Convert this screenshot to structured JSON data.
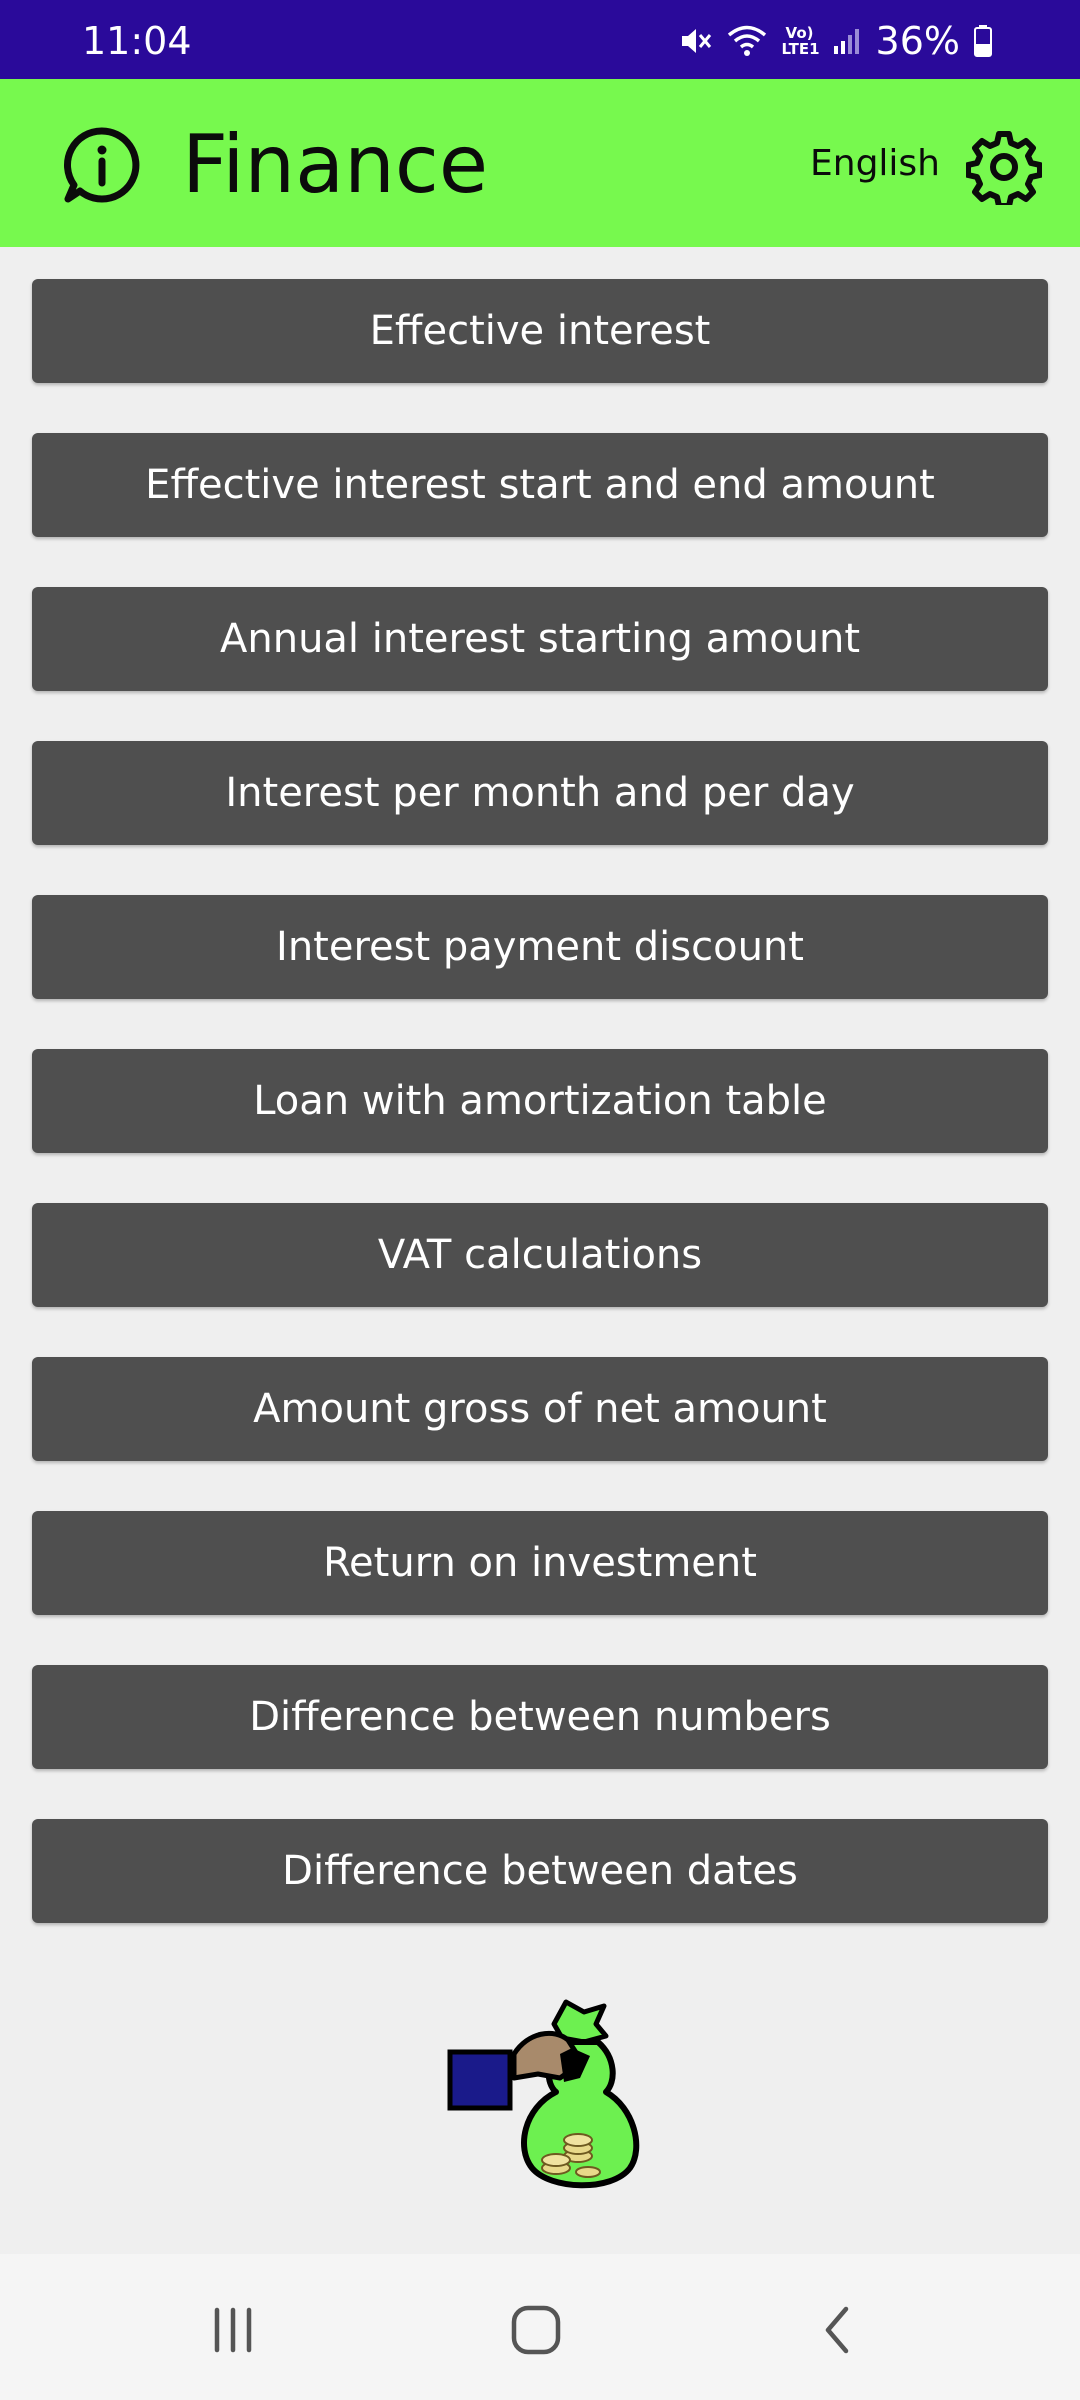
{
  "status_bar": {
    "time": "11:04",
    "network": "Vo) LTE1",
    "battery": "36%"
  },
  "app_bar": {
    "title": "Finance",
    "language": "English",
    "background_color": "#77f94e"
  },
  "menu": {
    "items": [
      {
        "label": "Effective interest"
      },
      {
        "label": "Effective interest start and end amount"
      },
      {
        "label": "Annual interest starting amount"
      },
      {
        "label": "Interest per month and per day"
      },
      {
        "label": "Interest payment discount"
      },
      {
        "label": "Loan with amortization table"
      },
      {
        "label": "VAT calculations"
      },
      {
        "label": "Amount gross of net amount"
      },
      {
        "label": "Return on investment"
      },
      {
        "label": "Difference between numbers"
      },
      {
        "label": "Difference between dates"
      }
    ],
    "button_color": "#4f4f4f"
  },
  "icons": {
    "info": "info-icon",
    "settings": "gear-icon",
    "illustration": "money-bag-icon",
    "nav_recent": "recent-apps-icon",
    "nav_home": "home-icon",
    "nav_back": "back-icon"
  },
  "colors": {
    "status_bar": "#2a0a9a",
    "background": "#efefef"
  }
}
